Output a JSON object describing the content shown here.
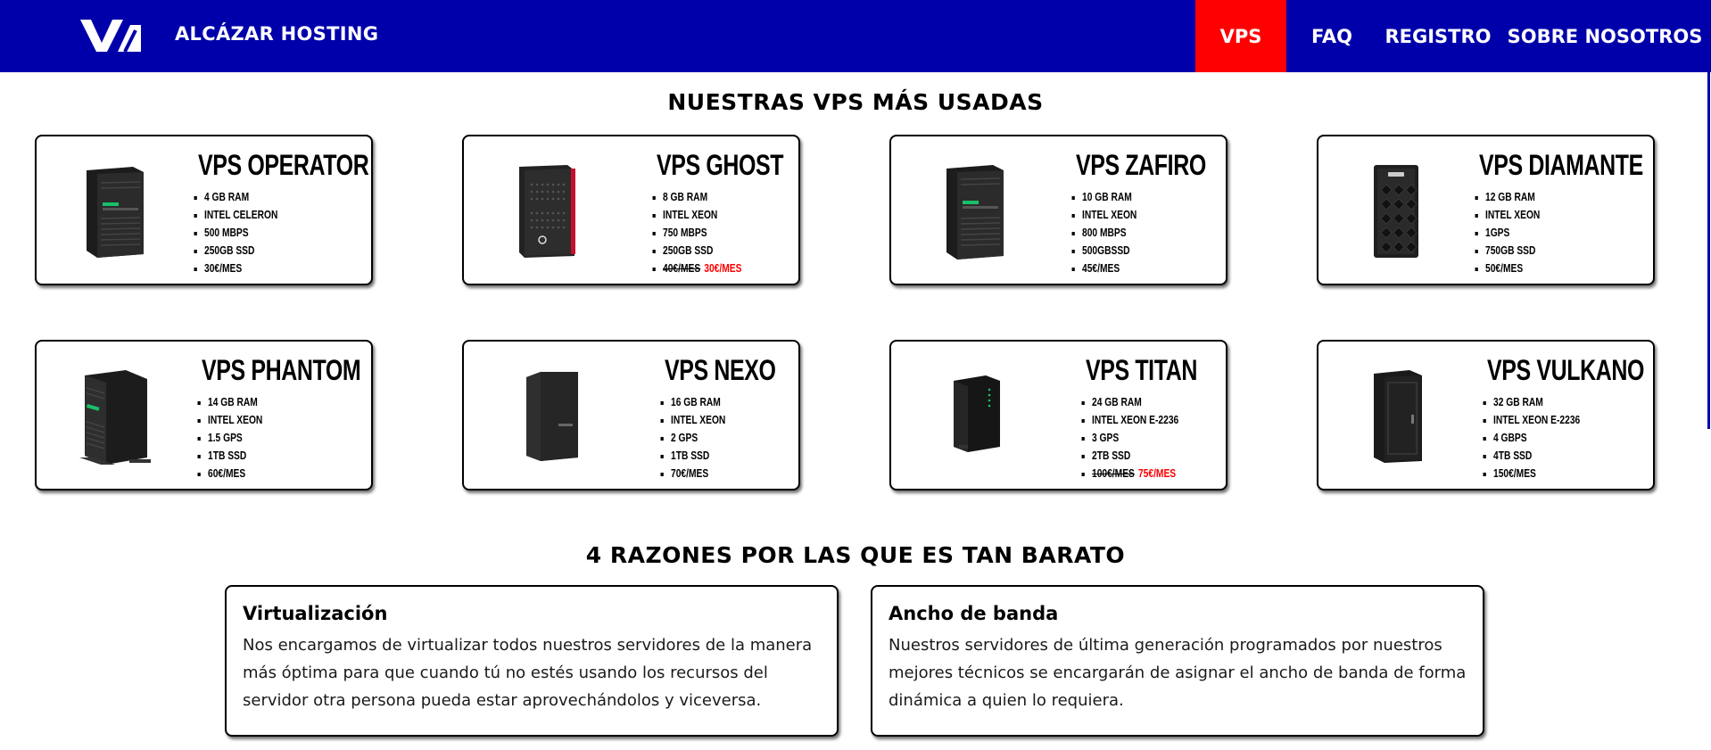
{
  "header": {
    "brand": "ALCÁZAR HOSTING",
    "nav": [
      "VPS",
      "FAQ",
      "REGISTRO",
      "SOBRE NOSOTROS"
    ],
    "active_nav": "VPS",
    "colors": {
      "bar": "#0000ab",
      "active": "#ff0000"
    }
  },
  "vps_section": {
    "title": "NUESTRAS VPS MÁS USADAS",
    "cards": [
      {
        "name": "VPS OPERATOR",
        "specs": [
          "4 GB RAM",
          "INTEL CELERON",
          "500 MBPS",
          "250GB SSD",
          "30€/MES"
        ],
        "image": "tower-server-icon"
      },
      {
        "name": "VPS GHOST",
        "specs": [
          "8 GB RAM",
          "INTEL XEON",
          "750 MBPS",
          "250GB SSD"
        ],
        "old_price": "40€/MES",
        "price": "30€/MES",
        "image": "tower-server-red-icon"
      },
      {
        "name": "VPS ZAFIRO",
        "specs": [
          "10 GB RAM",
          "INTEL XEON",
          "800 MBPS",
          "500GBSSD",
          "45€/MES"
        ],
        "image": "tower-server-icon"
      },
      {
        "name": "VPS DIAMANTE",
        "specs": [
          "12 GB RAM",
          "INTEL XEON",
          "1GPS",
          "750GB SSD",
          "50€/MES"
        ],
        "image": "tower-server-dell-icon"
      },
      {
        "name": "VPS PHANTOM",
        "specs": [
          "14 GB RAM",
          "INTEL XEON",
          "1.5 GPS",
          "1TB SSD",
          "60€/MES"
        ],
        "image": "large-tower-server-icon"
      },
      {
        "name": "VPS NEXO",
        "specs": [
          "16 GB RAM",
          "INTEL XEON",
          "2 GPS",
          "1TB SSD",
          "70€/MES"
        ],
        "image": "tower-server-icon"
      },
      {
        "name": "VPS TITAN",
        "specs": [
          "24 GB RAM",
          "INTEL XEON E-2236",
          "3 GPS",
          "2TB SSD"
        ],
        "old_price": "100€/MES",
        "price": "75€/MES",
        "image": "nas-server-icon"
      },
      {
        "name": "VPS VULKANO",
        "specs": [
          "32 GB RAM",
          "INTEL XEON E-2236",
          "4 GBPS",
          "4TB SSD",
          "150€/MES"
        ],
        "image": "rack-cabinet-icon"
      }
    ]
  },
  "reasons_section": {
    "title": "4 RAZONES POR LAS QUE ES TAN BARATO",
    "items": [
      {
        "title": "Virtualización",
        "text": "Nos encargamos de virtualizar todos nuestros servidores de la manera más óptima para que cuando tú no estés usando los recursos del servidor otra persona pueda estar aprovechándolos y viceversa."
      },
      {
        "title": "Ancho de banda",
        "text": "Nuestros servidores de última generación programados por nuestros mejores técnicos se encargarán de asignar el ancho de banda de forma dinámica a quien lo requiera."
      }
    ]
  }
}
